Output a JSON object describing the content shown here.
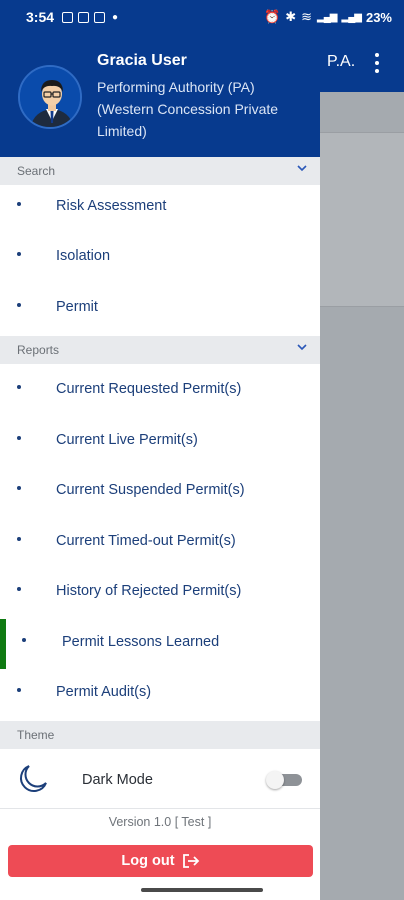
{
  "status_bar": {
    "time": "3:54",
    "battery": "23%",
    "signal": "5G"
  },
  "app_header": {
    "title_abbr": "P.A."
  },
  "profile": {
    "name": "Gracia User",
    "role": "Performing Authority (PA) (Western Concession Private Limited)"
  },
  "sections": {
    "search": {
      "title": "Search",
      "items": [
        "Risk Assessment",
        "Isolation",
        "Permit"
      ]
    },
    "reports": {
      "title": "Reports",
      "items": [
        "Current Requested Permit(s)",
        "Current Live Permit(s)",
        "Current Suspended Permit(s)",
        "Current Timed-out Permit(s)",
        "History of Rejected Permit(s)",
        "Permit Lessons Learned",
        "Permit Audit(s)"
      ]
    },
    "theme": {
      "title": "Theme",
      "dark_mode_label": "Dark Mode",
      "dark_mode_enabled": false
    }
  },
  "footer": {
    "version": "Version 1.0 [ Test ]",
    "logout_label": "Log out"
  },
  "colors": {
    "primary": "#073a8e",
    "active_indicator": "#0f7a12",
    "logout": "#ee4b55",
    "menu_text": "#1c3f7a"
  }
}
